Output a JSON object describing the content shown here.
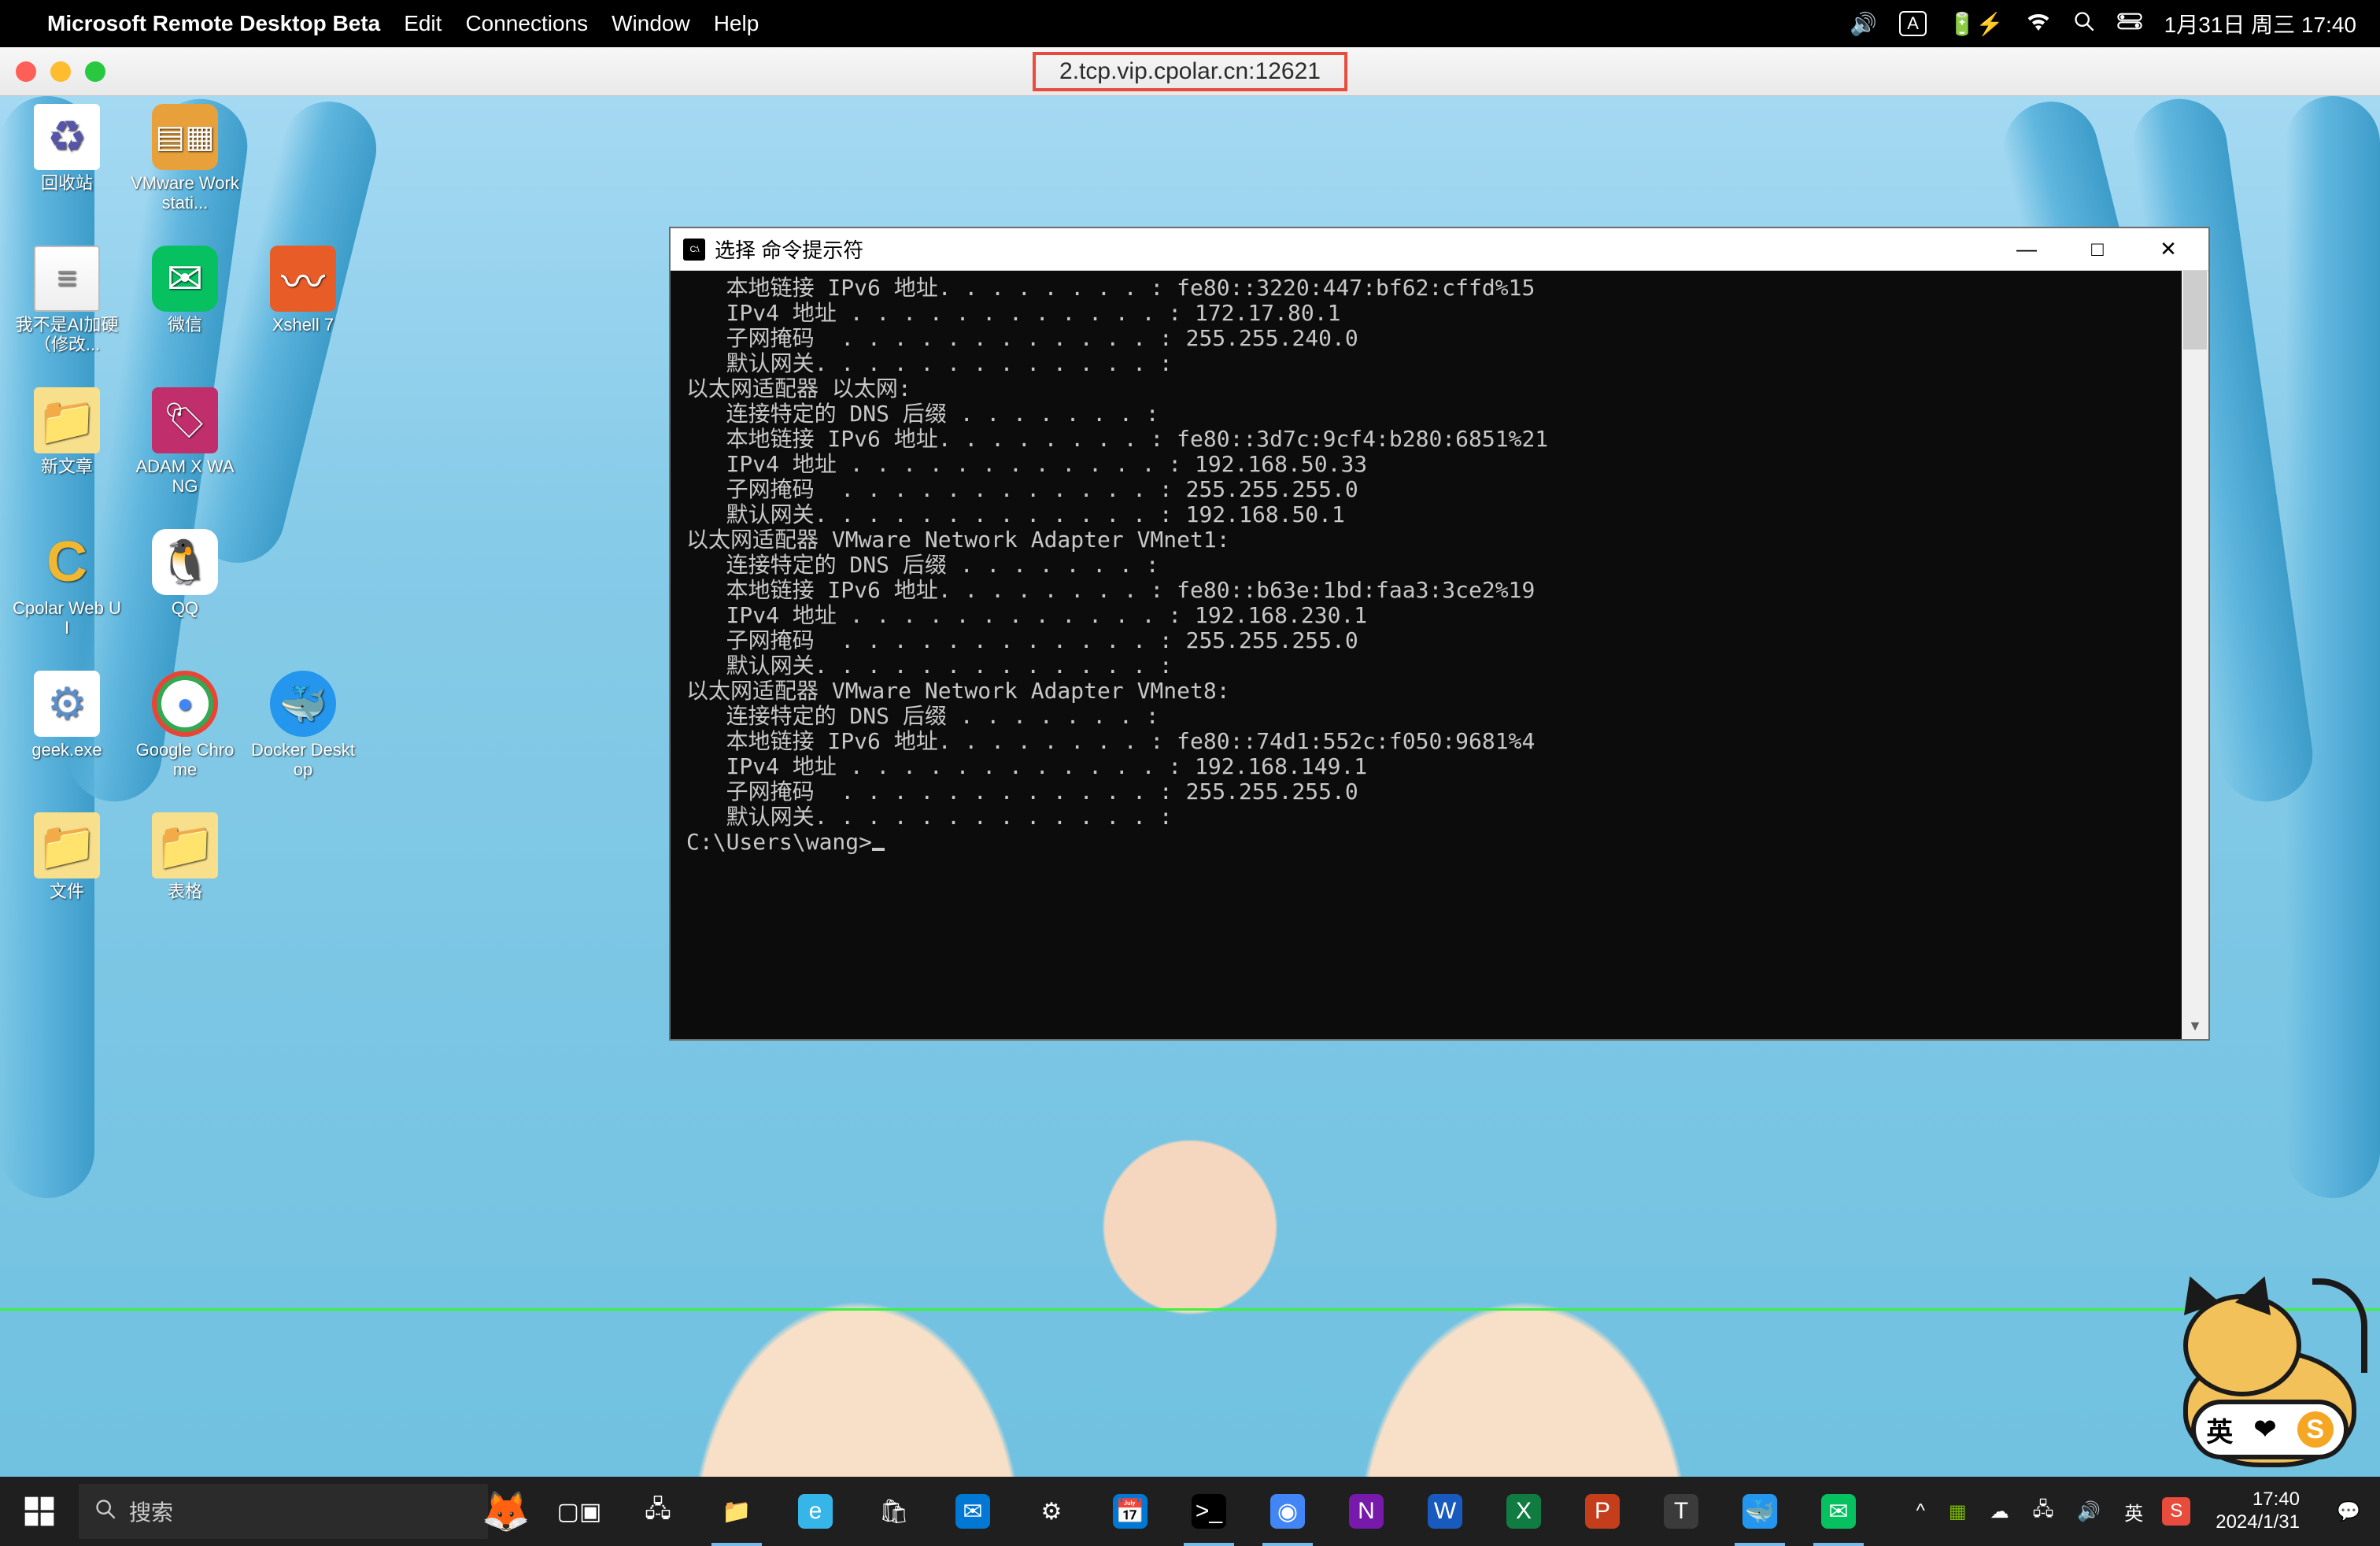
{
  "mac_menubar": {
    "app_name": "Microsoft Remote Desktop Beta",
    "menus": [
      "Edit",
      "Connections",
      "Window",
      "Help"
    ],
    "input_indicator": "A",
    "datetime": "1月31日 周三  17:40"
  },
  "rd_window": {
    "title": "2.tcp.vip.cpolar.cn:12621"
  },
  "desktop_icons": [
    {
      "id": "recycle-bin",
      "label": "回收站",
      "glyph": "recycle"
    },
    {
      "id": "vmware",
      "label": "VMware Workstati...",
      "glyph": "vmware"
    },
    {
      "id": "placeholder-0",
      "label": "",
      "glyph": ""
    },
    {
      "id": "ai-note-txt",
      "label": "我不是AI加硬（修改...",
      "glyph": "txt"
    },
    {
      "id": "wechat",
      "label": "微信",
      "glyph": "wechat"
    },
    {
      "id": "xshell7",
      "label": "Xshell 7",
      "glyph": "xshell"
    },
    {
      "id": "new-article",
      "label": "新文章",
      "glyph": "folder"
    },
    {
      "id": "adam-x-wang",
      "label": "ADAM X WANG",
      "glyph": "adam"
    },
    {
      "id": "placeholder-1",
      "label": "",
      "glyph": ""
    },
    {
      "id": "cpolar-web-ui",
      "label": "Cpolar Web UI",
      "glyph": "cpolar"
    },
    {
      "id": "qq",
      "label": "QQ",
      "glyph": "qq"
    },
    {
      "id": "placeholder-2",
      "label": "",
      "glyph": ""
    },
    {
      "id": "geek-exe",
      "label": "geek.exe",
      "glyph": "geek"
    },
    {
      "id": "google-chrome",
      "label": "Google Chrome",
      "glyph": "chrome"
    },
    {
      "id": "docker-desktop",
      "label": "Docker Desktop",
      "glyph": "docker"
    },
    {
      "id": "files-folder",
      "label": "文件",
      "glyph": "folder"
    },
    {
      "id": "tables-folder",
      "label": "表格",
      "glyph": "folder"
    }
  ],
  "cmd_window": {
    "title": "选择 命令提示符",
    "lines": [
      "   本地链接 IPv6 地址. . . . . . . . : fe80::3220:447:bf62:cffd%15",
      "   IPv4 地址 . . . . . . . . . . . . : 172.17.80.1",
      "   子网掩码  . . . . . . . . . . . . : 255.255.240.0",
      "   默认网关. . . . . . . . . . . . . :",
      "",
      "以太网适配器 以太网:",
      "",
      "   连接特定的 DNS 后缀 . . . . . . . :",
      "   本地链接 IPv6 地址. . . . . . . . : fe80::3d7c:9cf4:b280:6851%21",
      "   IPv4 地址 . . . . . . . . . . . . : 192.168.50.33",
      "   子网掩码  . . . . . . . . . . . . : 255.255.255.0",
      "   默认网关. . . . . . . . . . . . . : 192.168.50.1",
      "",
      "以太网适配器 VMware Network Adapter VMnet1:",
      "",
      "   连接特定的 DNS 后缀 . . . . . . . :",
      "   本地链接 IPv6 地址. . . . . . . . : fe80::b63e:1bd:faa3:3ce2%19",
      "   IPv4 地址 . . . . . . . . . . . . : 192.168.230.1",
      "   子网掩码  . . . . . . . . . . . . : 255.255.255.0",
      "   默认网关. . . . . . . . . . . . . :",
      "",
      "以太网适配器 VMware Network Adapter VMnet8:",
      "",
      "   连接特定的 DNS 后缀 . . . . . . . :",
      "   本地链接 IPv6 地址. . . . . . . . : fe80::74d1:552c:f050:9681%4",
      "   IPv4 地址 . . . . . . . . . . . . : 192.168.149.1",
      "   子网掩码  . . . . . . . . . . . . : 255.255.255.0",
      "   默认网关. . . . . . . . . . . . . :",
      "",
      "C:\\Users\\wang>"
    ]
  },
  "mascot": {
    "pill_cn": "英",
    "pill_icon": "❤",
    "pill_s": "S"
  },
  "taskbar": {
    "search_placeholder": "搜索",
    "clock_time": "17:40",
    "clock_date": "2024/1/31",
    "ime_lang": "英",
    "tray_chevron": "^",
    "apps": [
      {
        "id": "task-view",
        "glyph": "▢▣",
        "color": "",
        "active": false
      },
      {
        "id": "network-panel",
        "glyph": "🖧",
        "color": "",
        "active": false
      },
      {
        "id": "file-explorer",
        "glyph": "📁",
        "color": "",
        "active": true
      },
      {
        "id": "edge",
        "glyph": "e",
        "color": "#36b6e8",
        "active": false
      },
      {
        "id": "ms-store",
        "glyph": "🛍",
        "color": "",
        "active": false
      },
      {
        "id": "mail",
        "glyph": "✉",
        "color": "#0078d4",
        "active": false
      },
      {
        "id": "settings",
        "glyph": "⚙",
        "color": "",
        "active": false
      },
      {
        "id": "calendar",
        "glyph": "📅",
        "color": "#0078d4",
        "active": false
      },
      {
        "id": "terminal",
        "glyph": ">_",
        "color": "#000",
        "active": true
      },
      {
        "id": "chrome",
        "glyph": "◉",
        "color": "#4285f4",
        "active": true
      },
      {
        "id": "onenote",
        "glyph": "N",
        "color": "#7719aa",
        "active": false
      },
      {
        "id": "word",
        "glyph": "W",
        "color": "#185abd",
        "active": false
      },
      {
        "id": "excel",
        "glyph": "X",
        "color": "#107c41",
        "active": false
      },
      {
        "id": "powerpoint",
        "glyph": "P",
        "color": "#c43e1c",
        "active": false
      },
      {
        "id": "todo",
        "glyph": "T",
        "color": "#3b3b3b",
        "active": false
      },
      {
        "id": "docker",
        "glyph": "🐳",
        "color": "#2496ed",
        "active": true
      },
      {
        "id": "wechat-task",
        "glyph": "✉",
        "color": "#07c160",
        "active": true
      }
    ]
  }
}
